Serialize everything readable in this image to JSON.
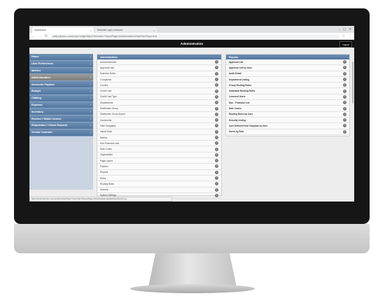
{
  "browser": {
    "tabs": [
      {
        "title": "Dashboard"
      },
      {
        "title": "Netsuite Login | Intranet"
      }
    ],
    "controls": [
      "−",
      "▢",
      "✕"
    ],
    "back_icon": "back-arrow-icon",
    "url": "unify.bamboo.com/unify/Config/ObjectTree/index?ParentPage=Administration&HideFilterPanel=true"
  },
  "app": {
    "title": "Administration",
    "logout_label": "Logout"
  },
  "sidebar": {
    "items": [
      {
        "label": "Home",
        "active": false
      },
      {
        "label": "User Preferences",
        "active": false
      },
      {
        "label": "Metrics",
        "active": false
      },
      {
        "label": "Administration",
        "active": true
      },
      {
        "label": "Accounts Payable",
        "active": false
      },
      {
        "label": "Budget",
        "active": false
      },
      {
        "label": "Catalog",
        "active": false
      },
      {
        "label": "Expense",
        "active": false
      },
      {
        "label": "Inventory",
        "active": false
      },
      {
        "label": "Receive / Match Invoice",
        "active": false
      },
      {
        "label": "Requisition / Check Request",
        "active": false
      },
      {
        "label": "Vendor Contract",
        "active": false
      }
    ]
  },
  "admin_panel": {
    "title": "Administration",
    "items": [
      "Announcements",
      "Approval Lists",
      "Business Rules",
      "Companies",
      "Country",
      "Credit Card",
      "Credit Card Type",
      "Departments",
      "Distribution Group",
      "Distribution Group Import",
      "Documents",
      "Filter Templates",
      "Import Data",
      "Metrics",
      "Non-Financial Lists",
      "Note Codes",
      "Organization",
      "Page Layout",
      "Position",
      "Reports",
      "Roles",
      "Routing Rules",
      "Security",
      "System Settings"
    ]
  },
  "reports_panel": {
    "title": "Reports",
    "items": [
      "Approval List",
      "Approval List by User",
      "Audit Detail",
      "Department Listing",
      "Group Routing Rules",
      "Individual Routing Rules",
      "Licensed Users",
      "Non - Financial List",
      "Note Codes",
      "Routing Rules by User",
      "Security Listing",
      "User Defined Field Template by User",
      "Users by Role"
    ]
  },
  "status_url": "https://unify.bamboo.com/unify/Config/ObjectTree/index?ParentPage=Administration&HideFilterPanel=true"
}
